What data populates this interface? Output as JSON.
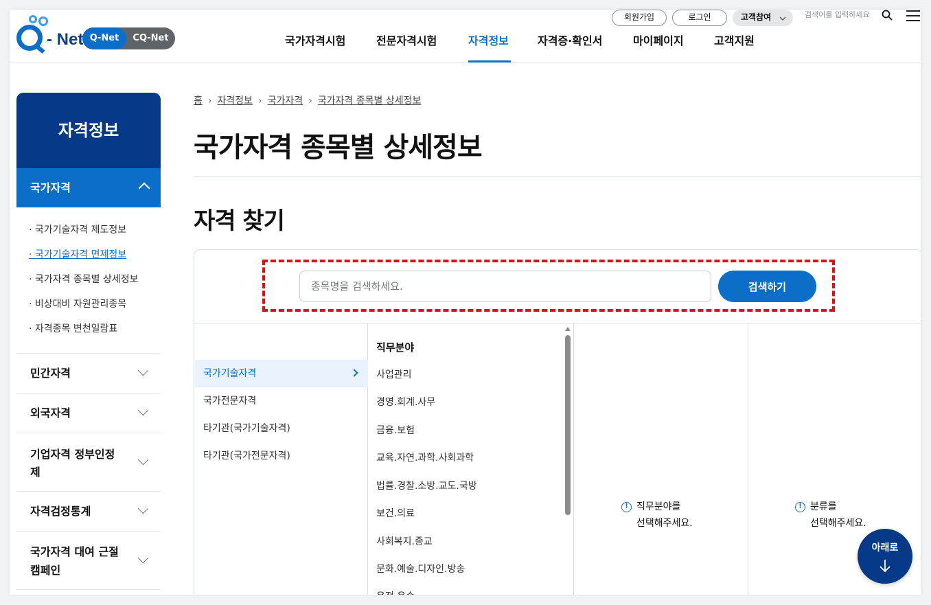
{
  "header": {
    "logo_text": "- Net",
    "switch": {
      "qnet": "Q-Net",
      "cqnet": "CQ-Net"
    },
    "util": {
      "join": "회원가입",
      "login": "로그인",
      "customer": "고객참여"
    },
    "search_placeholder": "검색어를 입력하세요",
    "nav": [
      "국가자격시험",
      "전문자격시험",
      "자격정보",
      "자격증·확인서",
      "마이페이지",
      "고객지원"
    ],
    "nav_active_index": 2
  },
  "sidebar": {
    "title": "자격정보",
    "active_section": "국가자격",
    "sub_items": [
      "국가기술자격 제도정보",
      "국가기술자격 면제정보",
      "국가자격 종목별 상세정보",
      "비상대비 자원관리종목",
      "자격종목 변천일람표"
    ],
    "sub_active_index": 1,
    "sections": [
      {
        "label": "민간자격"
      },
      {
        "label": "외국자격"
      },
      {
        "label_line1": "기업자격 정부인정",
        "label_line2": "제"
      },
      {
        "label": "자격검정통계"
      },
      {
        "label_line1": "국가자격 대여 근절",
        "label_line2": "캠페인"
      }
    ]
  },
  "breadcrumb": [
    "홈",
    "자격정보",
    "국가자격",
    "국가자격 종목별 상세정보"
  ],
  "page_title": "국가자격 종목별 상세정보",
  "section_title": "자격 찾기",
  "search": {
    "placeholder": "종목명을 검색하세요.",
    "button": "검색하기"
  },
  "categories": [
    "국가기술자격",
    "국가전문자격",
    "타기관(국가기술자격)",
    "타기관(국가전문자격)"
  ],
  "categories_active_index": 0,
  "fields": {
    "header": "직무분야",
    "items": [
      "사업관리",
      "경영.회계.사무",
      "금융.보험",
      "교육.자연.과학.사회과학",
      "법률.경찰.소방.교도.국방",
      "보건.의료",
      "사회복지.종교",
      "문화.예술.디자인.방송",
      "운전.운송"
    ]
  },
  "notices": {
    "field": {
      "line1": "직무분야를",
      "line2": "선택해주세요."
    },
    "class": {
      "line1": "분류를",
      "line2": "선택해주세요."
    }
  },
  "fab": {
    "label": "아래로"
  },
  "colors": {
    "primary": "#0b6fc9",
    "navy": "#063a88",
    "highlight": "#e01010"
  }
}
